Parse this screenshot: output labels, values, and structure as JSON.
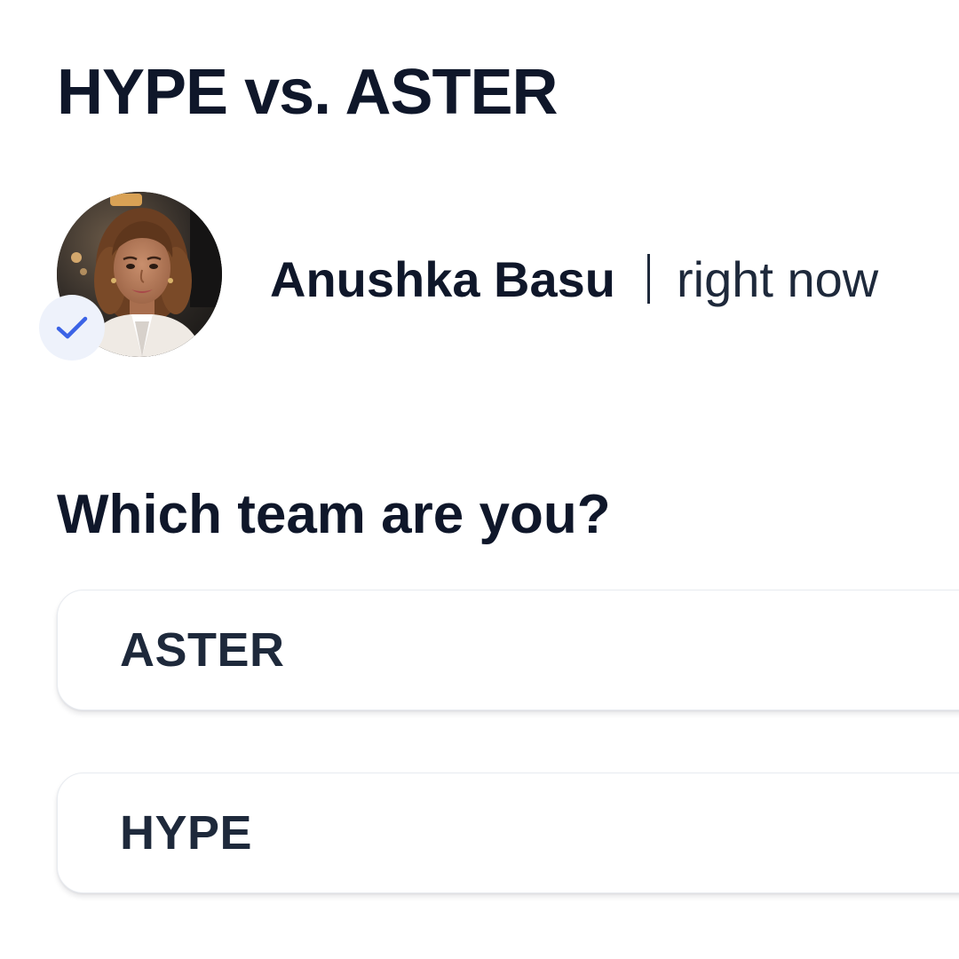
{
  "post": {
    "title": "HYPE vs. ASTER"
  },
  "author": {
    "name": "Anushka Basu",
    "timestamp": "right now",
    "verified": true,
    "avatar_icon": "profile-photo",
    "badge_icon": "checkmark-icon"
  },
  "poll": {
    "question": "Which team are you?",
    "options": [
      {
        "label": "ASTER"
      },
      {
        "label": "HYPE"
      }
    ]
  },
  "colors": {
    "text_primary": "#0f172a",
    "badge_background": "#eef2fb",
    "badge_check": "#3b63e6"
  }
}
